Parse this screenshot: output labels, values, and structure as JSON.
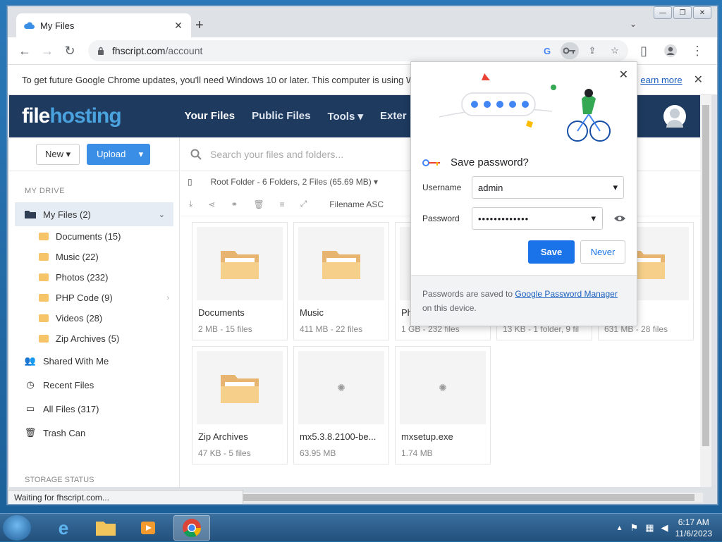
{
  "browser": {
    "tab_title": "My Files",
    "tab_close": "✕",
    "new_tab": "+",
    "url_host": "fhscript.com",
    "url_path": "/account",
    "infobar_message": "To get future Google Chrome updates, you'll need Windows 10 or later. This computer is using W",
    "infobar_link": "earn more",
    "status_text": "Waiting for fhscript.com..."
  },
  "site": {
    "logo_file": "file",
    "logo_hosting": "hosting",
    "nav": [
      "Your Files",
      "Public Files",
      "Tools ▾",
      "Exter"
    ],
    "new_button": "New ▾",
    "upload_button": "Upload",
    "search_placeholder": "Search your files and folders...",
    "breadcrumb": "Root Folder - 6 Folders, 2 Files (65.69 MB) ▾",
    "sort_label": "Filename ASC"
  },
  "sidebar": {
    "heading": "MY DRIVE",
    "my_files": "My Files (2)",
    "folders": [
      "Documents (15)",
      "Music (22)",
      "Photos (232)",
      "PHP Code (9)",
      "Videos (28)",
      "Zip Archives (5)"
    ],
    "links": [
      "Shared With Me",
      "Recent Files",
      "All Files (317)",
      "Trash Can"
    ],
    "storage_heading": "STORAGE STATUS"
  },
  "files": [
    {
      "name": "Documents",
      "meta": "2 MB - 15 files",
      "kind": "folder"
    },
    {
      "name": "Music",
      "meta": "411 MB - 22 files",
      "kind": "folder"
    },
    {
      "name": "Pho",
      "meta": "1 GB - 232 files",
      "kind": "folder"
    },
    {
      "name": "",
      "meta": "13 KB - 1 folder, 9 fil",
      "kind": "folder"
    },
    {
      "name": "",
      "meta": "631 MB - 28 files",
      "kind": "folder"
    },
    {
      "name": "Zip Archives",
      "meta": "47 KB - 5 files",
      "kind": "folder"
    },
    {
      "name": "mx5.3.8.2100-be...",
      "meta": "63.95 MB",
      "kind": "file"
    },
    {
      "name": "mxsetup.exe",
      "meta": "1.74 MB",
      "kind": "file"
    }
  ],
  "popup": {
    "title": "Save password?",
    "username_label": "Username",
    "username_value": "admin",
    "password_label": "Password",
    "password_value": "•••••••••••••",
    "save_button": "Save",
    "never_button": "Never",
    "footer_prefix": "Passwords are saved to ",
    "footer_link": "Google Password Manager",
    "footer_suffix": " on this device."
  },
  "taskbar": {
    "time": "6:17 AM",
    "date": "11/6/2023"
  },
  "colors": {
    "site_header": "#1e3a5f",
    "accent": "#1a73e8",
    "upload": "#3a8ee6",
    "folder": "#f6c56a"
  }
}
